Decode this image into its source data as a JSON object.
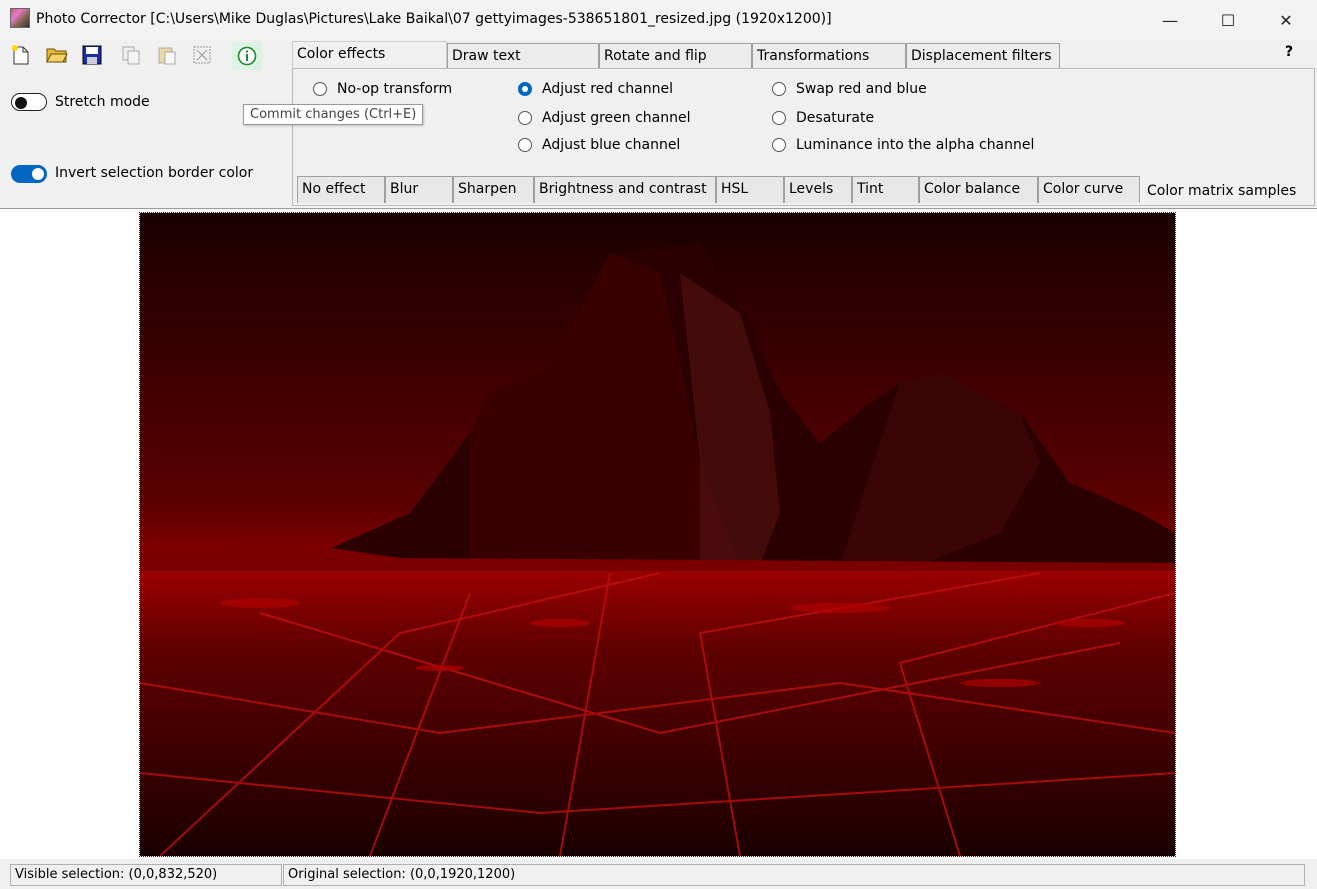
{
  "window": {
    "title": "Photo Corrector [C:\\Users\\Mike Duglas\\Pictures\\Lake Baikal\\07 gettyimages-538651801_resized.jpg (1920x1200)]",
    "app_icon": "photo-app-icon",
    "minimize_glyph": "—",
    "maximize_glyph": "☐",
    "close_glyph": "✕"
  },
  "toolbar": {
    "icons": [
      "new-file-icon",
      "open-folder-icon",
      "save-icon",
      "copy-icon",
      "paste-icon",
      "crop-icon",
      "commit-info-icon"
    ]
  },
  "options": {
    "stretch_mode": {
      "label": "Stretch mode",
      "on": false
    },
    "invert_border": {
      "label": "Invert selection border color",
      "on": true
    }
  },
  "tooltip": "Commit changes (Ctrl+E)",
  "tabs": [
    {
      "label": "Color effects",
      "active": true
    },
    {
      "label": "Draw text",
      "active": false
    },
    {
      "label": "Rotate and flip",
      "active": false
    },
    {
      "label": "Transformations",
      "active": false
    },
    {
      "label": "Displacement filters",
      "active": false
    }
  ],
  "help_label": "?",
  "effects": {
    "col1": [
      {
        "label": "No-op transform",
        "selected": false
      }
    ],
    "col2": [
      {
        "label": "Adjust red channel",
        "selected": true
      },
      {
        "label": "Adjust green channel",
        "selected": false
      },
      {
        "label": "Adjust blue channel",
        "selected": false
      }
    ],
    "col3": [
      {
        "label": "Swap red and blue",
        "selected": false
      },
      {
        "label": "Desaturate",
        "selected": false
      },
      {
        "label": "Luminance into the alpha channel",
        "selected": false
      }
    ]
  },
  "subtabs": [
    {
      "label": "No effect"
    },
    {
      "label": "Blur"
    },
    {
      "label": "Sharpen"
    },
    {
      "label": "Brightness and contrast"
    },
    {
      "label": "HSL"
    },
    {
      "label": "Levels"
    },
    {
      "label": "Tint"
    },
    {
      "label": "Color balance"
    },
    {
      "label": "Color curve"
    },
    {
      "label": "Color matrix samples",
      "active": true
    }
  ],
  "status": {
    "visible_selection": "Visible selection: (0,0,832,520)",
    "original_selection": "Original selection: (0,0,1920,1200)"
  },
  "colors": {
    "accent": "#0067c0",
    "photo_tint": "#8b0000"
  }
}
